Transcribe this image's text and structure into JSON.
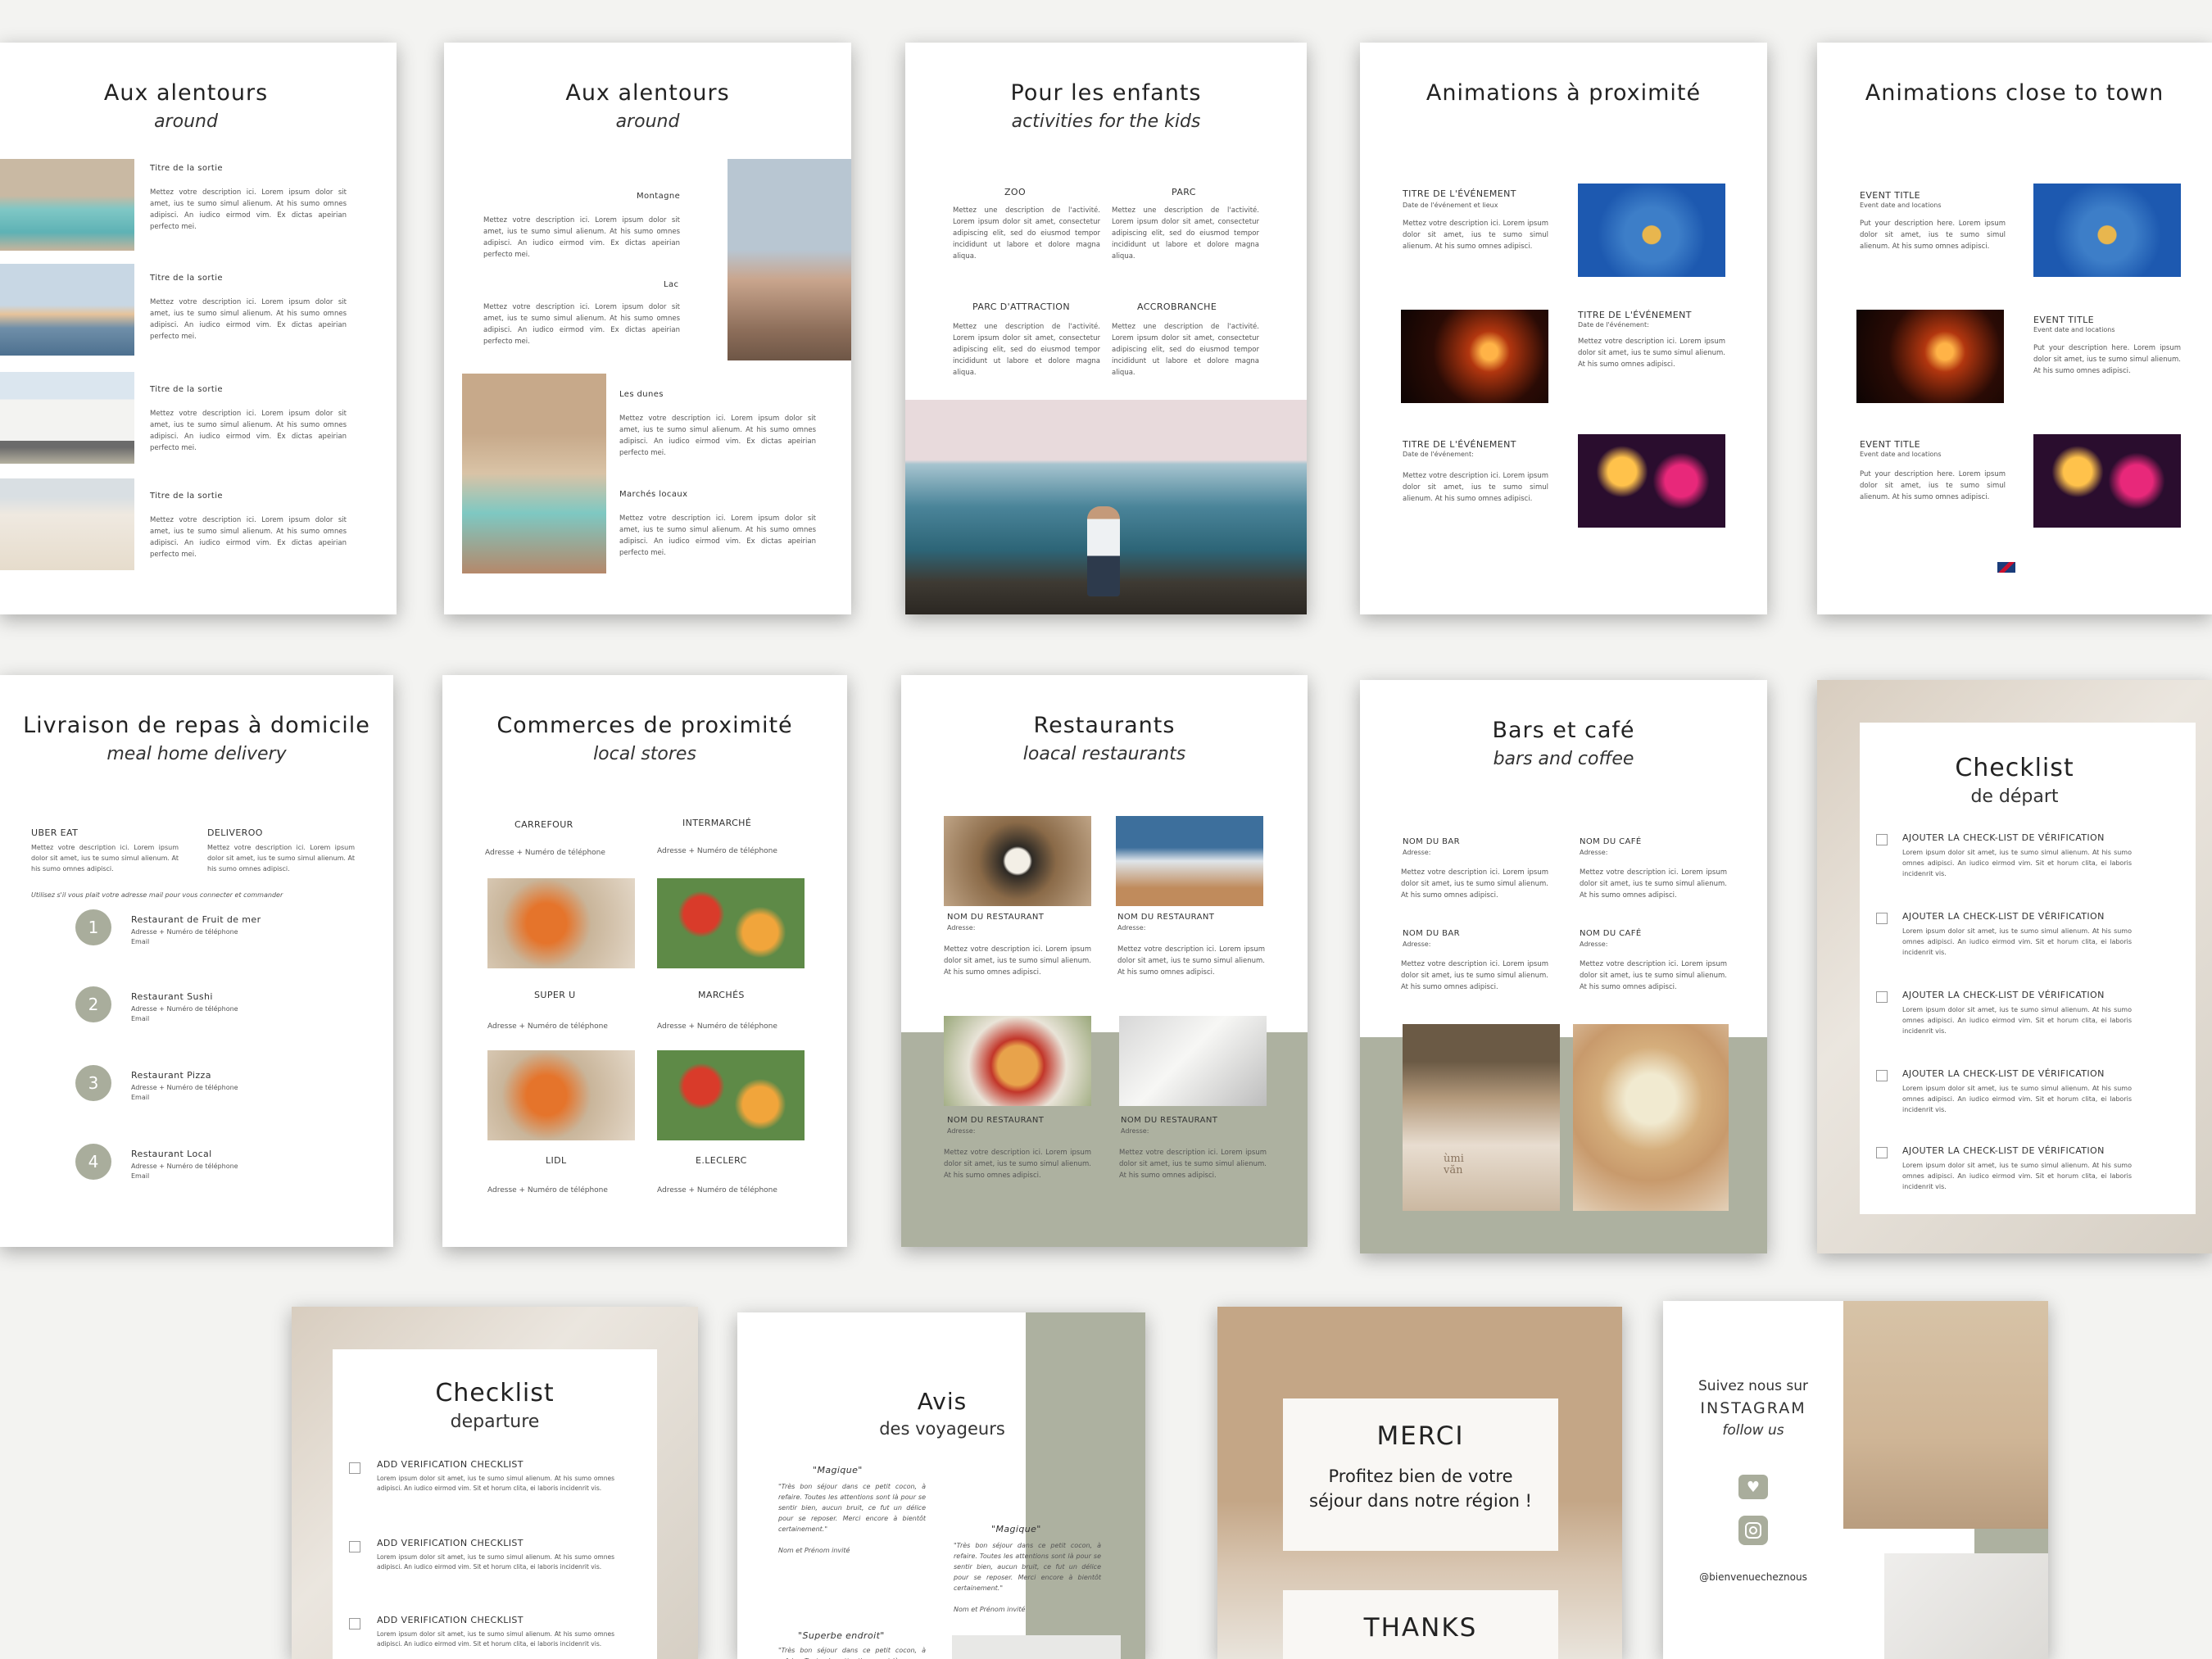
{
  "p1": {
    "title": "Aux alentours",
    "subtitle": "around",
    "items": [
      "Titre de la sortie",
      "Titre de la sortie",
      "Titre de la sortie",
      "Titre de la sortie"
    ],
    "lorem": "Mettez votre description ici. Lorem ipsum dolor sit amet, ius te sumo simul alienum. At his sumo omnes adipisci. An iudico eirmod vim. Ex dictas apeirian perfecto mei."
  },
  "p2": {
    "title": "Aux alentours",
    "subtitle": "around",
    "items": [
      "Montagne",
      "Lac",
      "Les dunes",
      "Marchés locaux"
    ],
    "lorem": "Mettez votre description ici. Lorem ipsum dolor sit amet, ius te sumo simul alienum. At his sumo omnes adipisci. An iudico eirmod vim. Ex dictas apeirian perfecto mei."
  },
  "p3": {
    "title": "Pour les enfants",
    "subtitle": "activities for the kids",
    "items": [
      "ZOO",
      "PARC",
      "PARC D'ATTRACTION",
      "ACCROBRANCHE"
    ],
    "lorem": "Mettez une description de l'activité. Lorem ipsum dolor sit amet, consectetur adipiscing elit, sed do eiusmod tempor incididunt ut labore et dolore magna aliqua."
  },
  "p4": {
    "title": "Animations à proximité",
    "items": [
      "TITRE DE L'ÉVÉNEMENT",
      "TITRE DE L'ÉVÉNEMENT",
      "TITRE DE L'ÉVÉNEMENT"
    ],
    "dates": [
      "Date de l'événement et lieux",
      "Date de l'événement:",
      "Date de l'événement:"
    ],
    "lorem": "Mettez votre description ici. Lorem ipsum dolor sit amet, ius te sumo simul alienum. At his sumo omnes adipisci."
  },
  "p5": {
    "title": "Animations close to town",
    "items": [
      "EVENT TITLE",
      "EVENT TITLE",
      "EVENT TITLE"
    ],
    "dates": [
      "Event date and locations",
      "Event date and locations",
      "Event date and locations"
    ],
    "lorem": "Put your description here. Lorem ipsum dolor sit amet, ius te sumo simul alienum. At his sumo omnes adipisci."
  },
  "p6": {
    "title": "Livraison de repas à domicile",
    "subtitle": "meal home delivery",
    "apps": [
      "UBER EAT",
      "DELIVEROO"
    ],
    "lorem": "Mettez votre description ici. Lorem ipsum dolor sit amet, ius te sumo simul alienum. At his sumo omnes adipisci.",
    "note": "Utilisez s'il vous plait votre adresse mail pour vous connecter et commander",
    "numbers": [
      "1",
      "2",
      "3",
      "4"
    ],
    "restaurants": [
      "Restaurant de Fruit de mer",
      "Restaurant Sushi",
      "Restaurant Pizza",
      "Restaurant Local"
    ],
    "line2": "Adresse + Numéro de téléphone",
    "line3": "Email"
  },
  "p7": {
    "title": "Commerces de proximité",
    "subtitle": "local stores",
    "stores": [
      "CARREFOUR",
      "INTERMARCHÉ",
      "SUPER U",
      "MARCHÉS",
      "LIDL",
      "E.LECLERC"
    ],
    "info": "Adresse + Numéro de téléphone"
  },
  "p8": {
    "title": "Restaurants",
    "subtitle": "loacal restaurants",
    "names": [
      "NOM DU RESTAURANT",
      "NOM DU RESTAURANT",
      "NOM DU RESTAURANT",
      "NOM DU RESTAURANT"
    ],
    "addr": "Adresse:",
    "lorem": "Mettez votre description ici. Lorem ipsum dolor sit amet, ius te sumo simul alienum. At his sumo omnes adipisci."
  },
  "p9": {
    "title": "Bars et café",
    "subtitle": "bars and coffee",
    "names": [
      "NOM DU BAR",
      "NOM DU CAFÉ",
      "NOM DU BAR",
      "NOM DU CAFÉ"
    ],
    "addr": "Adresse:",
    "lorem": "Mettez votre description ici. Lorem ipsum dolor sit amet, ius te sumo simul alienum. At his sumo omnes adipisci.",
    "cup": "ùmi văn"
  },
  "p10": {
    "title": "Checklist",
    "subtitle": "de départ",
    "item": "AJOUTER LA CHECK-LIST DE VÉRIFICATION",
    "lorem": "Lorem ipsum dolor sit amet, ius te sumo simul alienum. At his sumo omnes adipisci. An iudico eirmod vim. Sit et horum clita, ei laboris incidenrit vis."
  },
  "p11": {
    "title": "Checklist",
    "subtitle": "departure",
    "item": "ADD VERIFICATION CHECKLIST",
    "lorem": "Lorem ipsum dolor sit amet, ius te sumo simul alienum. At his sumo omnes adipisci. An iudico eirmod vim. Sit et horum clita, ei laboris incidenrit vis."
  },
  "p12": {
    "title": "Avis",
    "subtitle": "des voyageurs",
    "q1": "\"Magique\"",
    "q2": "\"Magique\"",
    "q3": "\"Superbe endroit\"",
    "review": "\"Très bon séjour dans ce petit cocon, à refaire. Toutes les attentions sont là pour se sentir bien, aucun bruit, ce fut un délice pour se reposer. Merci encore à bientôt certainement.\"",
    "author": "Nom et Prénom invité"
  },
  "p13": {
    "merci": "MERCI",
    "line": "Profitez bien de votre séjour dans notre région !",
    "thanks": "THANKS"
  },
  "p14": {
    "follow": "Suivez nous sur",
    "insta": "INSTAGRAM",
    "followus": "follow us",
    "handle": "@bienvenuecheznous"
  }
}
